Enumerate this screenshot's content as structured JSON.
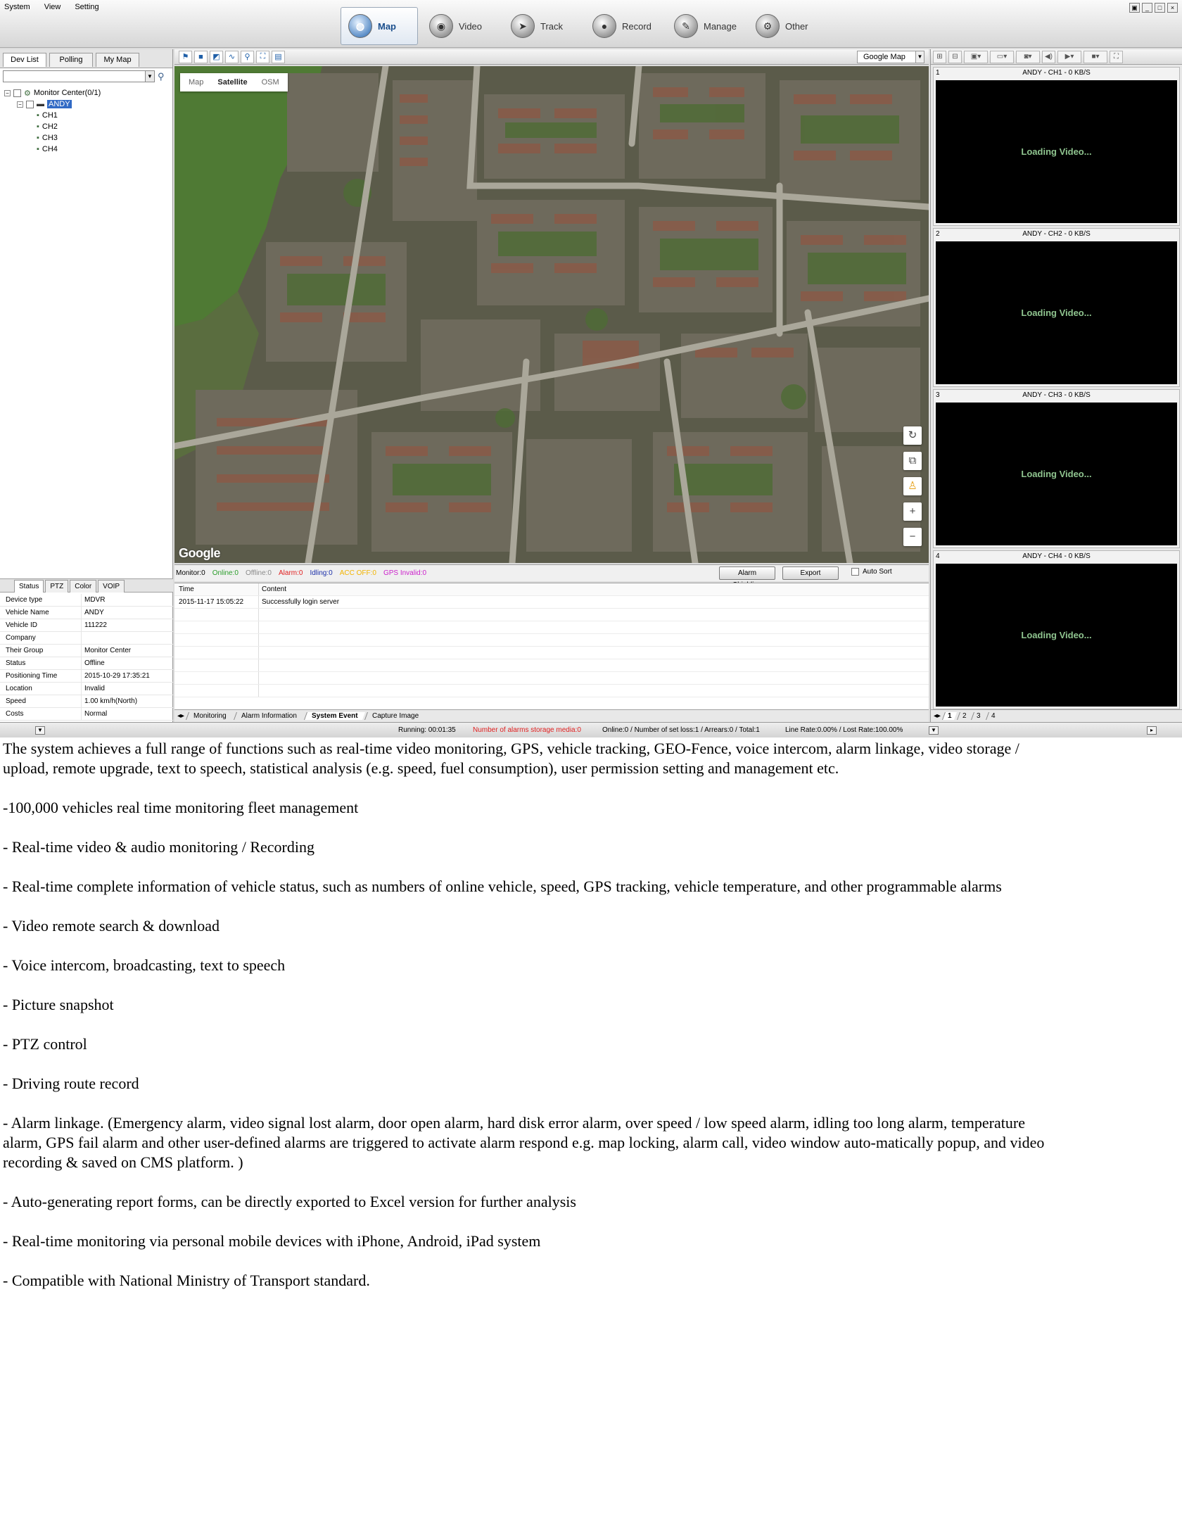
{
  "menu": [
    "System",
    "View",
    "Setting"
  ],
  "modules": [
    {
      "label": "Map",
      "icon": "globe-icon",
      "active": true
    },
    {
      "label": "Video",
      "icon": "camera-icon",
      "active": false
    },
    {
      "label": "Track",
      "icon": "track-icon",
      "active": false
    },
    {
      "label": "Record",
      "icon": "record-icon",
      "active": false
    },
    {
      "label": "Manage",
      "icon": "manage-icon",
      "active": false
    },
    {
      "label": "Other",
      "icon": "gear-icon",
      "active": false
    }
  ],
  "left": {
    "tabs": [
      "Dev List",
      "Polling",
      "My Map"
    ],
    "tree": {
      "root": "Monitor Center(0/1)",
      "device": "ANDY",
      "channels": [
        "CH1",
        "CH2",
        "CH3",
        "CH4"
      ]
    },
    "status_tabs": [
      "Status",
      "PTZ",
      "Color",
      "VOIP"
    ],
    "status": [
      {
        "k": "Device type",
        "v": "MDVR"
      },
      {
        "k": "Vehicle Name",
        "v": "ANDY"
      },
      {
        "k": "Vehicle ID",
        "v": "111222"
      },
      {
        "k": "Company",
        "v": ""
      },
      {
        "k": "Their Group",
        "v": "Monitor Center"
      },
      {
        "k": "Status",
        "v": "Offline"
      },
      {
        "k": "Positioning Time",
        "v": "2015-10-29 17:35:21"
      },
      {
        "k": "Location",
        "v": "Invalid"
      },
      {
        "k": "Speed",
        "v": "1.00 km/h(North)"
      },
      {
        "k": "Costs",
        "v": "Normal"
      }
    ]
  },
  "map": {
    "provider": "Google Map",
    "types": [
      "Map",
      "Satellite",
      "OSM"
    ],
    "active_type": "Satellite",
    "logo": "Google"
  },
  "monitor": {
    "monitor": "Monitor:0",
    "online": "Online:0",
    "offline": "Offline:0",
    "alarm": "Alarm:0",
    "idling": "Idling:0",
    "acc_off": "ACC OFF:0",
    "gps_invalid": "GPS Invalid:0",
    "alarm_shielding": "Alarm Shielding",
    "export": "Export",
    "auto_sort": "Auto Sort"
  },
  "events": {
    "headers": [
      "Time",
      "Content"
    ],
    "rows": [
      {
        "time": "2015-11-17 15:05:22",
        "content": "Successfully login server"
      }
    ],
    "tabs": [
      "Monitoring",
      "Alarm Information",
      "System Event",
      "Capture Image"
    ],
    "active_tab": "System Event"
  },
  "video": {
    "channels": [
      {
        "index": "1",
        "caption": "ANDY - CH1 - 0 KB/S",
        "status": "Loading Video..."
      },
      {
        "index": "2",
        "caption": "ANDY - CH2 - 0 KB/S",
        "status": "Loading Video..."
      },
      {
        "index": "3",
        "caption": "ANDY - CH3 - 0 KB/S",
        "status": "Loading Video..."
      },
      {
        "index": "4",
        "caption": "ANDY - CH4 - 0 KB/S",
        "status": "Loading Video..."
      }
    ],
    "pages": [
      "1",
      "2",
      "3",
      "4"
    ]
  },
  "statusbar": {
    "running": "Running: 00:01:35",
    "alarm_storage": "Number of alarms storage media:0",
    "online": "Online:0 / Number of set loss:1 / Arrears:0 / Total:1",
    "rate": "Line Rate:0.00% / Lost Rate:100.00%"
  },
  "doc": {
    "intro": "The system achieves a full range of functions such as real-time video monitoring, GPS, vehicle tracking, GEO-Fence, voice intercom, alarm linkage, video storage / upload, remote upgrade, text to speech, statistical analysis (e.g. speed, fuel consumption), user permission setting and management etc.",
    "features": [
      "-100,000 vehicles real time monitoring fleet management",
      "- Real-time video & audio monitoring / Recording",
      "- Real-time complete information of vehicle status, such as numbers of online vehicle, speed, GPS tracking, vehicle temperature, and other programmable alarms",
      "- Video remote search & download",
      "- Voice intercom, broadcasting, text to speech",
      "- Picture snapshot",
      "- PTZ control",
      "- Driving route record",
      "- Alarm linkage. (Emergency alarm, video signal lost alarm, door open alarm, hard disk error alarm, over speed / low speed alarm, idling too long alarm, temperature alarm, GPS fail alarm and other user-defined alarms are triggered to activate alarm respond e.g. map locking, alarm call, video window auto-matically popup, and video recording & saved on CMS platform. )",
      "- Auto-generating report forms, can be directly exported to Excel version for further analysis",
      "- Real-time monitoring via personal mobile devices with iPhone, Android, iPad system",
      "- Compatible with National Ministry of Transport standard."
    ]
  }
}
